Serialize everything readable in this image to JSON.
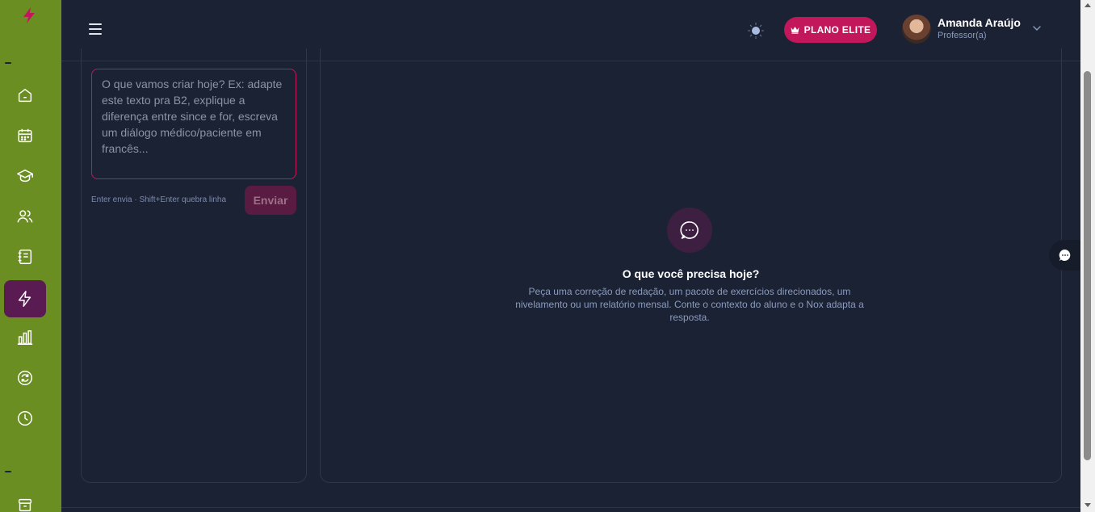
{
  "colors": {
    "rail": "#6b8e23",
    "background": "#1b2233",
    "accent": "#c2185b",
    "active_item": "#5a1b52",
    "muted_text": "#8a9bbf"
  },
  "rail": {
    "logo": "lightning-logo-icon",
    "items": [
      {
        "icon": "home-icon"
      },
      {
        "icon": "calendar-icon"
      },
      {
        "icon": "graduation-cap-icon"
      },
      {
        "icon": "users-icon"
      },
      {
        "icon": "notebook-icon"
      },
      {
        "icon": "lightning-icon",
        "active": true
      },
      {
        "icon": "bar-chart-icon"
      },
      {
        "icon": "refresh-icon"
      },
      {
        "icon": "clock-icon"
      },
      {
        "icon": "archive-icon"
      }
    ]
  },
  "header": {
    "plan_label": "PLANO ELITE",
    "user": {
      "name": "Amanda Araújo",
      "role": "Professor(a)"
    }
  },
  "composer": {
    "placeholder": "O que vamos criar hoje? Ex: adapte este texto pra B2, explique a diferença entre since e for, escreva um diálogo médico/paciente em francês...",
    "value": "",
    "hint": "Enter envia · Shift+Enter quebra linha",
    "send_label": "Enviar"
  },
  "empty_state": {
    "title": "O que você precisa hoje?",
    "description": "Peça uma correção de redação, um pacote de exercícios direcionados, um nivelamento ou um relatório mensal. Conte o contexto do aluno e o Nox adapta a resposta."
  }
}
